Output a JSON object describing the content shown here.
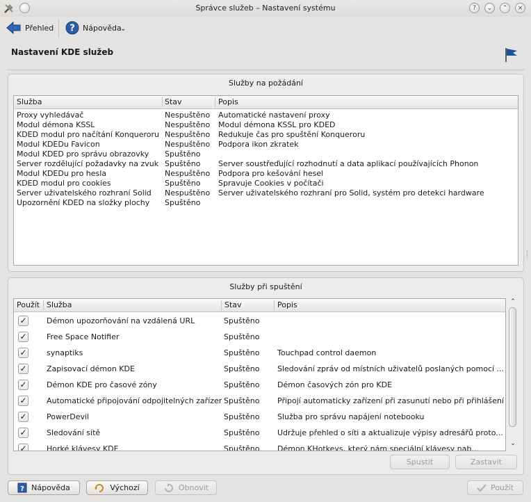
{
  "window": {
    "title": "Správce služeb – Nastavení systému",
    "controls": [
      "?",
      "⌄",
      "⌃",
      "×"
    ]
  },
  "toolbar": {
    "back_label": "Přehled",
    "help_label": "Nápověda",
    "help_dropdown": "⌄"
  },
  "page": {
    "title": "Nastavení KDE služeb"
  },
  "on_demand": {
    "title": "Služby na požádání",
    "headers": [
      "Služba",
      "Stav",
      "Popis"
    ],
    "rows": [
      {
        "service": "Proxy vyhledávač",
        "status": "Nespuštěno",
        "desc": "Automatické nastavení proxy"
      },
      {
        "service": "Modul démona KSSL",
        "status": "Nespuštěno",
        "desc": "Modul démona KSSL pro KDED"
      },
      {
        "service": "KDED modul pro načítání Konqueroru",
        "status": "Nespuštěno",
        "desc": "Redukuje čas pro spuštění Konqueroru"
      },
      {
        "service": "Modul KDEDu Favicon",
        "status": "Nespuštěno",
        "desc": "Podpora ikon zkratek"
      },
      {
        "service": "Modul KDED pro správu obrazovky",
        "status": "Spuštěno",
        "desc": ""
      },
      {
        "service": "Server rozdělující požadavky na zvuk",
        "status": "Spuštěno",
        "desc": "Server soustřeďující rozhodnutí a data aplikací používajících Phonon"
      },
      {
        "service": "Modul KDEDu pro hesla",
        "status": "Nespuštěno",
        "desc": "Podpora pro kešování hesel"
      },
      {
        "service": "KDED modul pro cookies",
        "status": "Spuštěno",
        "desc": "Spravuje Cookies v počítači"
      },
      {
        "service": "Server uživatelského rozhraní Solid",
        "status": "Nespuštěno",
        "desc": "Server uživatelského rozhraní pro Solid, systém pro detekci hardware"
      },
      {
        "service": "Upozornění KDED na složky plochy",
        "status": "Spuštěno",
        "desc": ""
      }
    ]
  },
  "startup": {
    "title": "Služby při spuštění",
    "headers": [
      "Použít",
      "Služba",
      "Stav",
      "Popis"
    ],
    "check_mark": "✓",
    "rows": [
      {
        "service": "Démon upozorňování na vzdálená URL",
        "status": "Spuštěno",
        "desc": ""
      },
      {
        "service": "Free Space Notifier",
        "status": "Spuštěno",
        "desc": ""
      },
      {
        "service": "synaptiks",
        "status": "Spuštěno",
        "desc": "Touchpad control daemon"
      },
      {
        "service": "Zapisovací démon KDE",
        "status": "Spuštěno",
        "desc": "Sledování zpráv od místních uživatelů poslaných pomocí ..."
      },
      {
        "service": "Démon KDE pro časové zóny",
        "status": "Spuštěno",
        "desc": "Démon časových zón pro KDE"
      },
      {
        "service": "Automatické připojování odpojitelných zařízení",
        "status": "Spuštěno",
        "desc": "Připojí automaticky zařízení při zasunutí nebo při přihlášení"
      },
      {
        "service": "PowerDevil",
        "status": "Spuštěno",
        "desc": "Služba pro správu napájení notebooku"
      },
      {
        "service": "Sledování sítě",
        "status": "Spuštěno",
        "desc": "Udržuje přehled o síti a aktualizuje výpisy adresářů proto..."
      },
      {
        "service": "Horké klávesy KDE",
        "status": "Spuštěno",
        "desc": "Démon KHotkeys, který nám speciální klávesy nab..."
      }
    ],
    "start_label": "Spustit",
    "stop_label": "Zastavit",
    "scroll_up": "⌃",
    "scroll_down": "⌄"
  },
  "footer": {
    "help_label": "Nápověda",
    "default_label": "Výchozí",
    "reset_label": "Obnovit",
    "apply_label": "Použít"
  },
  "colors": {
    "accent": "#2a5ea8",
    "window_bg": "#e4e3e1",
    "list_bg": "#ffffff"
  }
}
